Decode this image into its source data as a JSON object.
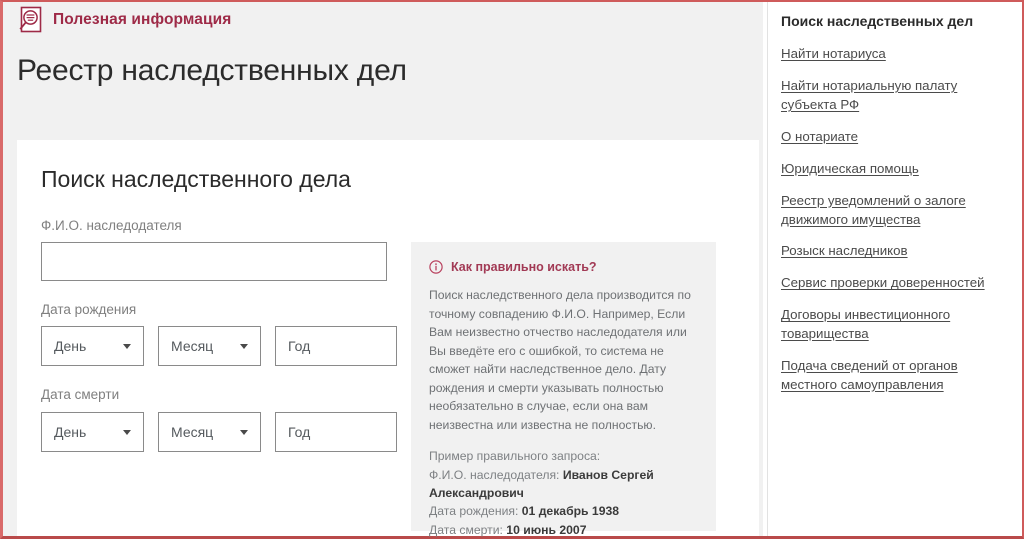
{
  "topbar": {
    "icon": "document-search-icon",
    "title": "Полезная информация"
  },
  "header": {
    "page_title": "Реестр наследственных дел"
  },
  "card": {
    "title": "Поиск наследственного дела"
  },
  "form": {
    "name_label": "Ф.И.О. наследодателя",
    "name_value": "",
    "name_placeholder": "",
    "birth_label": "Дата рождения",
    "death_label": "Дата смерти",
    "birth": {
      "day": "День",
      "month": "Месяц",
      "year_placeholder": "Год",
      "year_value": ""
    },
    "death": {
      "day": "День",
      "month": "Месяц",
      "year_placeholder": "Год",
      "year_value": ""
    }
  },
  "info": {
    "icon": "info-circle-icon",
    "heading": "Как правильно искать?",
    "body": "Поиск наследственного дела производится по точному совпадению Ф.И.О. Например, Если Вам неизвестно отчество наследодателя или Вы введёте его с ошибкой, то система не сможет найти наследственное дело. Дату рождения и смерти указывать полностью необязательно в случае, если она вам неизвестна или известна не полностью.",
    "example_title": "Пример правильного запроса:",
    "example_name_label": "Ф.И.О. наследодателя: ",
    "example_name_value": "Иванов Сергей Александрович",
    "example_birth_label": "Дата рождения: ",
    "example_birth_value": "01 декабрь 1938",
    "example_death_label": "Дата смерти: ",
    "example_death_value": "10 июнь 2007"
  },
  "sidebar": {
    "title": "Поиск наследственных дел",
    "links": [
      {
        "label": "Найти нотариуса"
      },
      {
        "label": "Найти нотариальную палату субъекта РФ"
      },
      {
        "label": "О нотариате"
      },
      {
        "label": "Юридическая помощь"
      },
      {
        "label": "Реестр уведомлений о залоге движимого имущества"
      },
      {
        "label": "Розыск наследников"
      },
      {
        "label": "Сервис проверки доверенностей"
      },
      {
        "label": "Договоры инвестиционного товарищества"
      },
      {
        "label": "Подача сведений от органов местного самоуправления"
      }
    ]
  },
  "colors": {
    "brand_crimson": "#9e2a47",
    "accent_red_border": "#cf5b5b",
    "info_accent": "#a23a55",
    "page_bg": "#f1f1f1",
    "card_bg": "#ffffff"
  }
}
